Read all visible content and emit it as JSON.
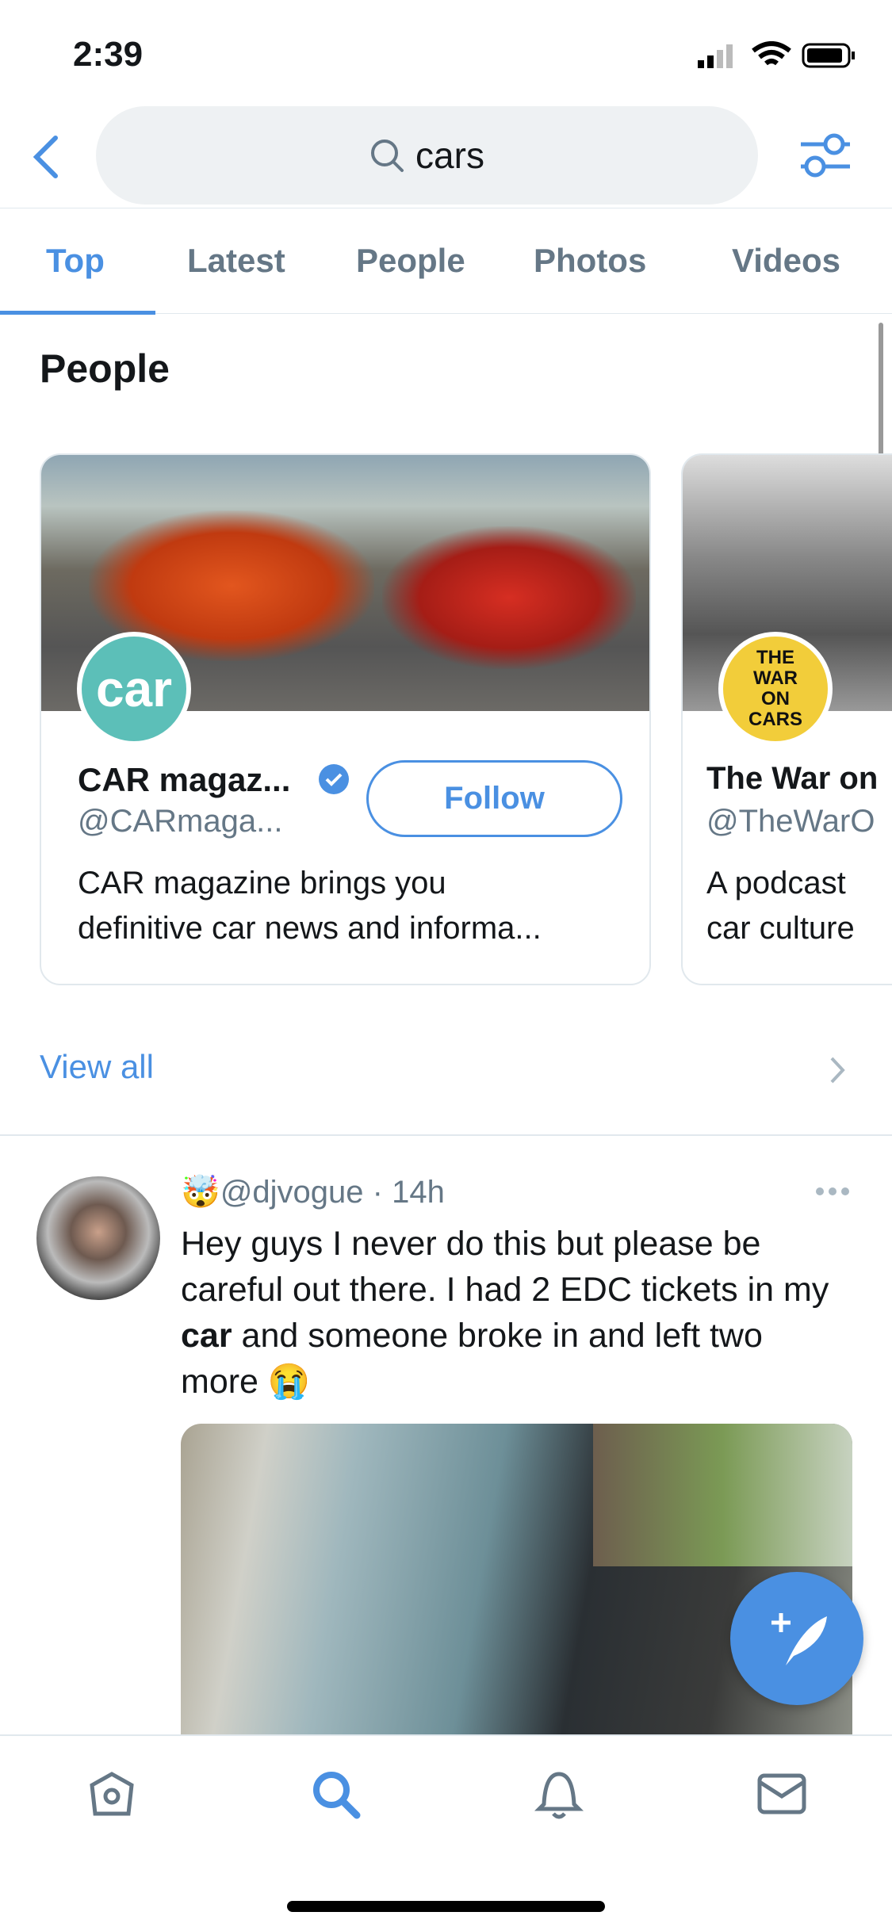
{
  "status": {
    "time": "2:39"
  },
  "search": {
    "query": "cars"
  },
  "tabs": [
    {
      "label": "Top",
      "active": true
    },
    {
      "label": "Latest"
    },
    {
      "label": "People"
    },
    {
      "label": "Photos"
    },
    {
      "label": "Videos"
    }
  ],
  "people": {
    "heading": "People",
    "view_all": "View all",
    "cards": [
      {
        "name": "CAR magaz...",
        "verified": true,
        "handle": "@CARmaga...",
        "follow": "Follow",
        "desc": [
          "CAR magazine brings you",
          "definitive car news and informa..."
        ],
        "avatar_text": "car"
      },
      {
        "name": "The War on",
        "handle": "@TheWarO",
        "desc": [
          "A podcast",
          "car culture"
        ],
        "avatar_text": "THE WAR ON CARS"
      }
    ]
  },
  "tweet": {
    "handle": "@djvogue",
    "time": "14h",
    "text_before": "Hey guys I never do this but please be careful out there. I had 2 EDC tickets in my ",
    "highlight": "car",
    "text_after": " and someone broke in and left two more 😭",
    "name_emoji": "🤯"
  },
  "colors": {
    "accent": "#4a90e2",
    "secondary_text": "#657786"
  }
}
